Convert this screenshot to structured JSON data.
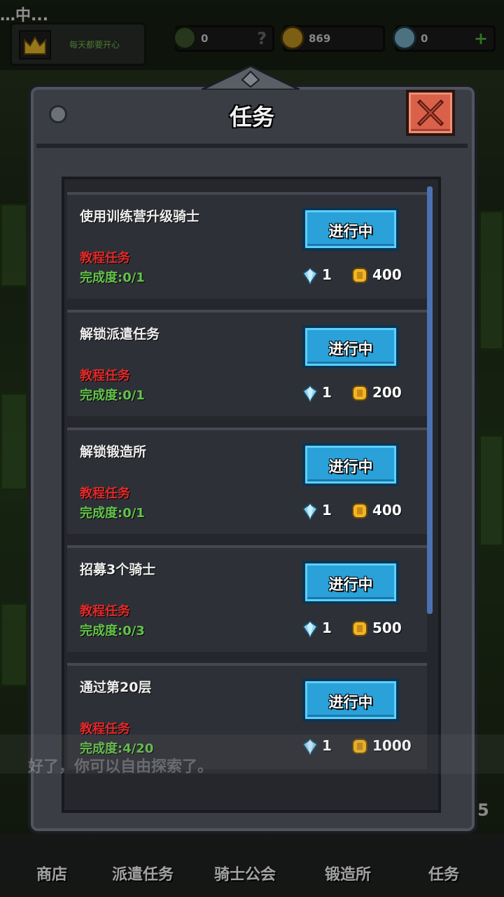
{
  "hud": {
    "status_text": "…中...",
    "crown_hint": "每天都要开心",
    "res1_value": "0",
    "res1_end": "?",
    "gold_value": "869",
    "gem_value": "0",
    "gem_end": "+"
  },
  "panel": {
    "title": "任务"
  },
  "quests": [
    {
      "name": "使用训练营升级骑士",
      "tag": "教程任务",
      "progress": "完成度:0/1",
      "button": "进行中",
      "gems": "1",
      "gold": "400"
    },
    {
      "name": "解锁派遣任务",
      "tag": "教程任务",
      "progress": "完成度:0/1",
      "button": "进行中",
      "gems": "1",
      "gold": "200"
    },
    {
      "name": "解锁锻造所",
      "tag": "教程任务",
      "progress": "完成度:0/1",
      "button": "进行中",
      "gems": "1",
      "gold": "400"
    },
    {
      "name": "招募3个骑士",
      "tag": "教程任务",
      "progress": "完成度:0/3",
      "button": "进行中",
      "gems": "1",
      "gold": "500"
    },
    {
      "name": "通过第20层",
      "tag": "教程任务",
      "progress": "完成度:4/20",
      "button": "进行中",
      "gems": "1",
      "gold": "1000"
    }
  ],
  "dialogue": "好了，你可以自由探索了。",
  "nav": [
    "商店",
    "派遣任务",
    "骑士公会",
    "锻造所",
    "任务"
  ],
  "nav_badge": "5",
  "colors": {
    "accent_button": "#2aa1d8",
    "tag_red": "#e02a2a",
    "progress_green": "#63c34a",
    "close_red": "#d9614a"
  },
  "icons": {
    "gem": "gem-icon",
    "gold": "gold-coin-icon",
    "close": "close-icon",
    "crown": "crown-icon"
  }
}
